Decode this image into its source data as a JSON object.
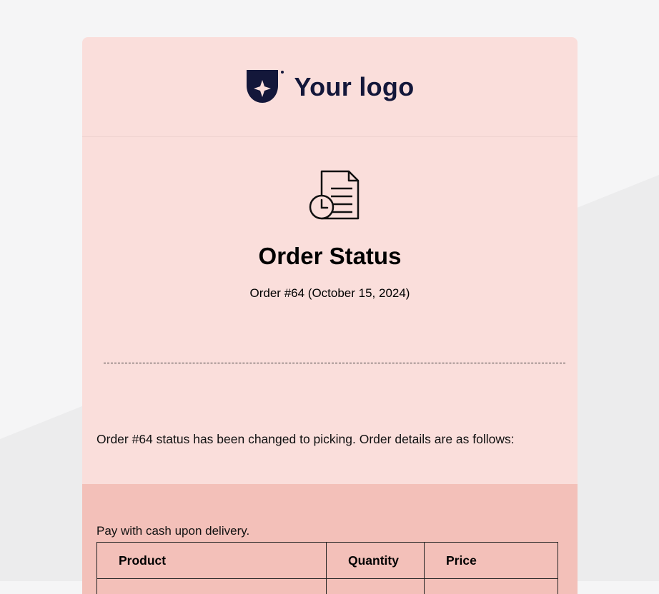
{
  "logo": {
    "text": "Your logo"
  },
  "hero": {
    "title": "Order Status",
    "subtitle": "Order #64 (October 15, 2024)"
  },
  "message": "Order #64 status has been changed to picking. Order details are as follows:",
  "details": {
    "payment_note": "Pay with cash upon delivery.",
    "table": {
      "columns": [
        "Product",
        "Quantity",
        "Price"
      ]
    }
  },
  "colors": {
    "page_bg": "#f5f5f6",
    "card_bg": "#fadedb",
    "details_bg": "#f3c0b9",
    "logo_color": "#13173a"
  }
}
